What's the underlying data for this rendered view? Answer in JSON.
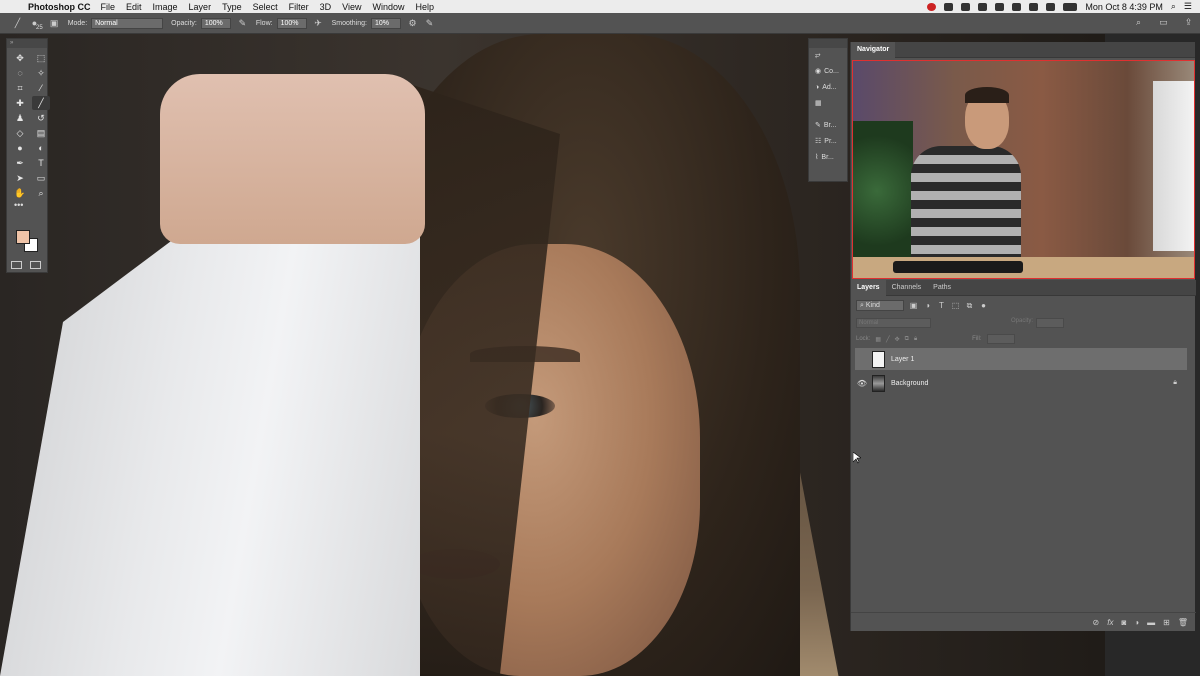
{
  "menubar": {
    "apple": "",
    "app_name": "Photoshop CC",
    "items": [
      "File",
      "Edit",
      "Image",
      "Layer",
      "Type",
      "Select",
      "Filter",
      "3D",
      "View",
      "Window",
      "Help"
    ],
    "clock": "Mon Oct 8  4:39 PM"
  },
  "optbar": {
    "brush_size": "25",
    "mode_label": "Mode:",
    "mode_value": "Normal",
    "opacity_label": "Opacity:",
    "opacity_value": "100%",
    "flow_label": "Flow:",
    "flow_value": "100%",
    "smoothing_label": "Smoothing:",
    "smoothing_value": "10%"
  },
  "minipanels": {
    "items": [
      {
        "icon": "history-icon",
        "label": ""
      },
      {
        "icon": "color-icon",
        "label": "Co..."
      },
      {
        "icon": "adjustments-icon",
        "label": "Ad..."
      },
      {
        "icon": "swatches-icon",
        "label": ""
      },
      {
        "icon": "brush-settings-icon",
        "label": "Br..."
      },
      {
        "icon": "properties-icon",
        "label": "Pr..."
      },
      {
        "icon": "brushes-icon",
        "label": "Br..."
      }
    ]
  },
  "navigator": {
    "tab": "Navigator"
  },
  "layers_panel": {
    "tabs": [
      "Layers",
      "Channels",
      "Paths"
    ],
    "kind_filter": "Kind",
    "blend_mode": "Normal",
    "opacity_label": "Opacity:",
    "opacity_value": "100%",
    "lock_label": "Lock:",
    "fill_label": "Fill:",
    "fill_value": "100%",
    "layers": [
      {
        "name": "Layer 1",
        "visible": false,
        "selected": true,
        "thumb": "white"
      },
      {
        "name": "Background",
        "visible": true,
        "selected": false,
        "thumb": "image",
        "locked": true
      }
    ]
  },
  "colors": {
    "foreground": "#f0c4a8",
    "background": "#ffffff",
    "panel": "#535353"
  }
}
